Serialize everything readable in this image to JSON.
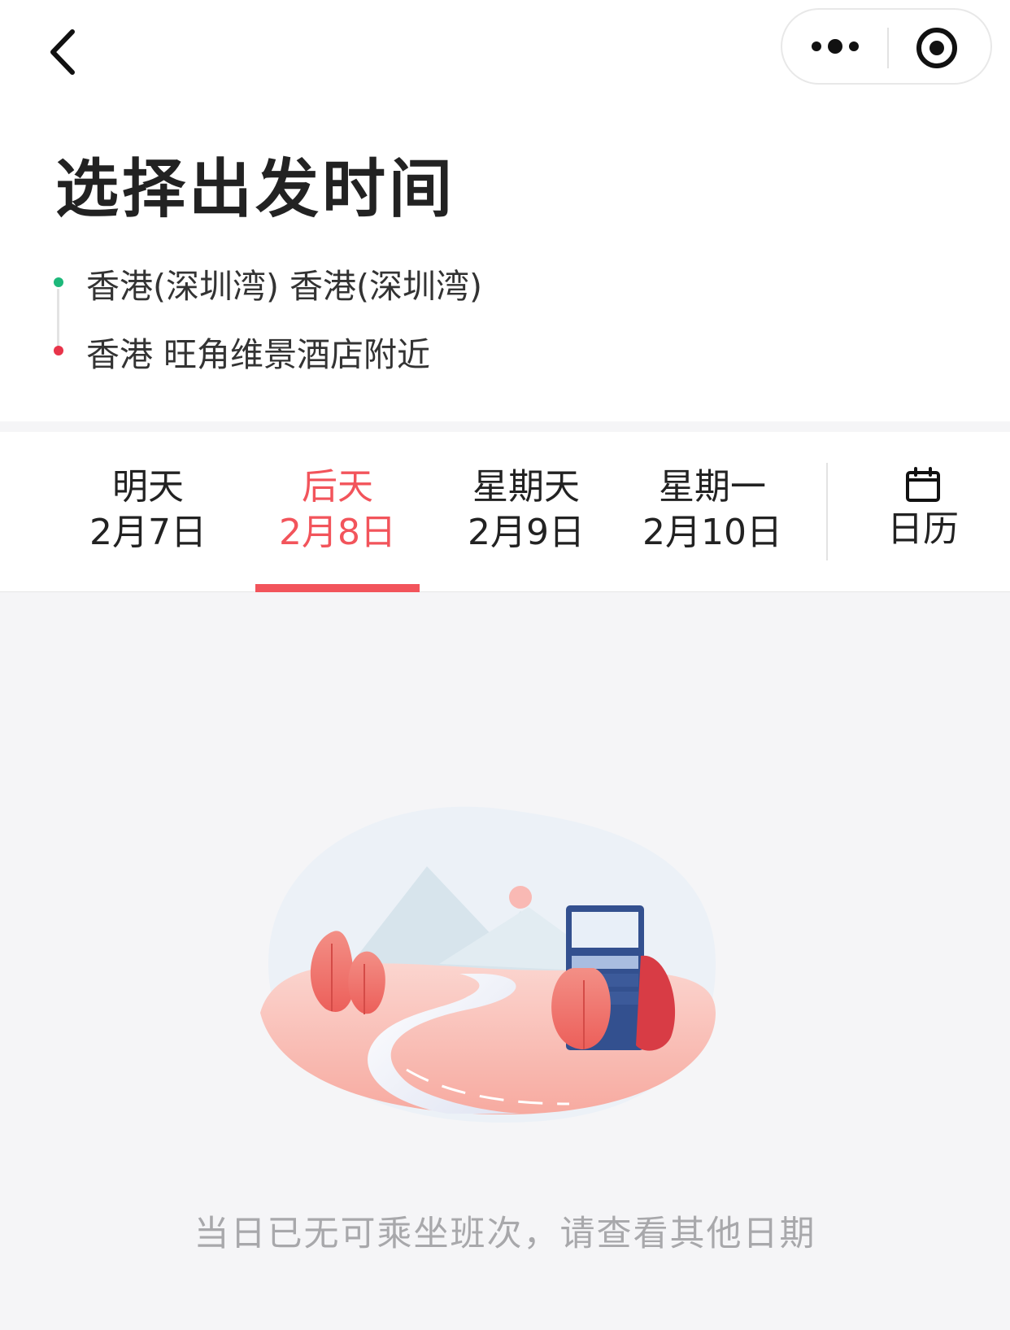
{
  "nav": {
    "back_icon": "chevron-left-icon",
    "more_icon": "more-dots-icon",
    "close_icon": "target-close-icon"
  },
  "header": {
    "title": "选择出发时间"
  },
  "route": {
    "from": "香港(深圳湾) 香港(深圳湾)",
    "to": "香港 旺角维景酒店附近",
    "from_color": "#1db87a",
    "to_color": "#e8344a"
  },
  "date_tabs": [
    {
      "day": "明天",
      "date": "2月7日",
      "selected": false
    },
    {
      "day": "后天",
      "date": "2月8日",
      "selected": true
    },
    {
      "day": "星期天",
      "date": "2月9日",
      "selected": false
    },
    {
      "day": "星期一",
      "date": "2月10日",
      "selected": false
    }
  ],
  "calendar": {
    "label": "日历",
    "icon": "calendar-icon"
  },
  "empty_state": {
    "illustration": "empty-road-bus-stop-illustration",
    "message": "当日已无可乘坐班次，请查看其他日期"
  },
  "colors": {
    "accent": "#f2545b",
    "background": "#f5f5f7"
  }
}
